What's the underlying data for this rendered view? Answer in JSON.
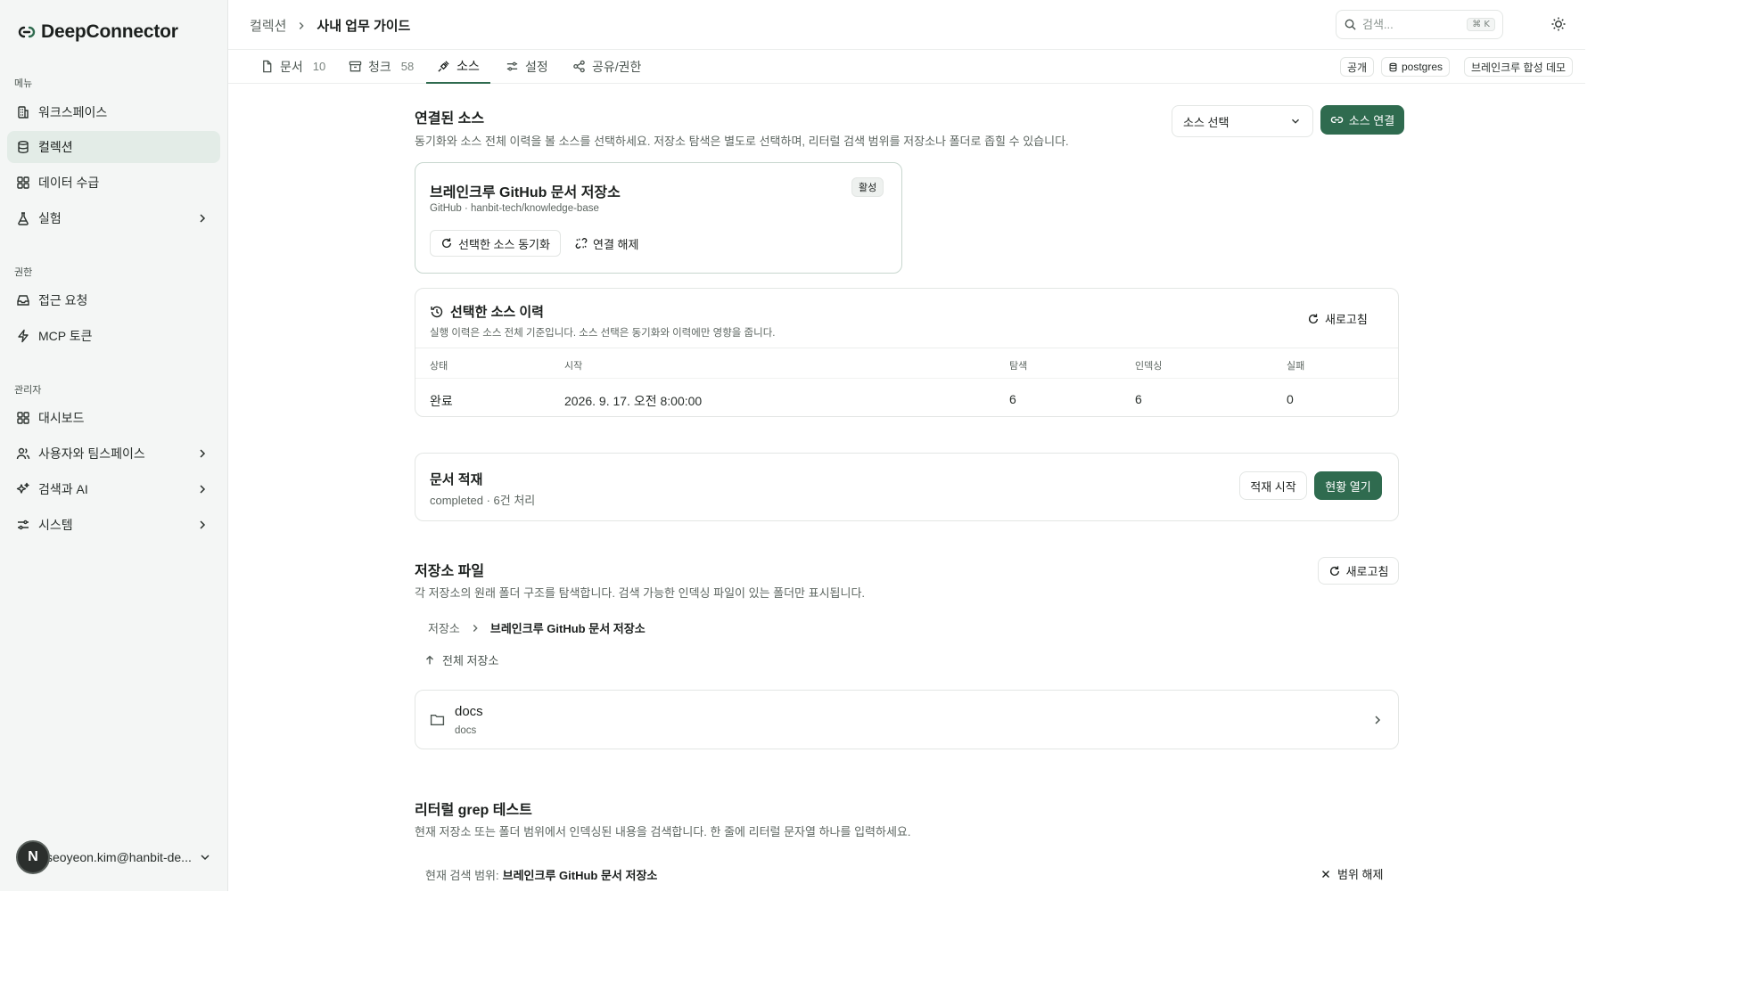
{
  "app": {
    "name": "DeepConnector"
  },
  "sidebar": {
    "sections": [
      {
        "label": "메뉴",
        "items": [
          {
            "label": "워크스페이스",
            "icon": "building-icon"
          },
          {
            "label": "컬렉션",
            "icon": "database-icon",
            "active": true
          },
          {
            "label": "데이터 수급",
            "icon": "grid-icon"
          },
          {
            "label": "실험",
            "icon": "flask-icon",
            "has_children": true
          }
        ]
      },
      {
        "label": "권한",
        "items": [
          {
            "label": "접근 요청",
            "icon": "inbox-icon"
          },
          {
            "label": "MCP 토큰",
            "icon": "bolt-icon"
          }
        ]
      },
      {
        "label": "관리자",
        "items": [
          {
            "label": "대시보드",
            "icon": "grid-icon"
          },
          {
            "label": "사용자와 팀스페이스",
            "icon": "users-icon",
            "has_children": true
          },
          {
            "label": "검색과 AI",
            "icon": "sparkles-icon",
            "has_children": true
          },
          {
            "label": "시스템",
            "icon": "sliders-icon",
            "has_children": true
          }
        ]
      }
    ],
    "user": {
      "initial": "N",
      "email": "seoyeon.kim@hanbit-de..."
    }
  },
  "header": {
    "breadcrumb": {
      "parent": "컬렉션",
      "current": "사내 업무 가이드"
    },
    "search": {
      "placeholder": "검색...",
      "shortcut": "⌘ K"
    }
  },
  "tabs": [
    {
      "label": "문서",
      "count": "10"
    },
    {
      "label": "청크",
      "count": "58"
    },
    {
      "label": "소스",
      "count": "",
      "active": true
    },
    {
      "label": "설정",
      "count": ""
    },
    {
      "label": "공유/권한",
      "count": ""
    }
  ],
  "tags": {
    "visibility": "공개",
    "db": "postgres",
    "workspace": "브레인크루 합성 데모"
  },
  "connected_sources": {
    "title": "연결된 소스",
    "description": "동기화와 소스 전체 이력을 볼 소스를 선택하세요. 저장소 탐색은 별도로 선택하며, 리터럴 검색 범위를 저장소나 폴더로 좁힐 수 있습니다.",
    "select_placeholder": "소스 선택",
    "connect_button": "소스 연결",
    "source": {
      "name": "브레인크루 GitHub 문서 저장소",
      "meta": "GitHub · hanbit-tech/knowledge-base",
      "status": "활성",
      "sync_button": "선택한 소스 동기화",
      "disconnect_button": "연결 해제"
    }
  },
  "history": {
    "title": "선택한 소스 이력",
    "note": "실행 이력은 소스 전체 기준입니다. 소스 선택은 동기화와 이력에만 영향을 줍니다.",
    "refresh": "새로고침",
    "columns": [
      "상태",
      "시작",
      "탐색",
      "인덱싱",
      "실패"
    ],
    "rows": [
      [
        "완료",
        "2026. 9. 17. 오전 8:00:00",
        "6",
        "6",
        "0"
      ]
    ]
  },
  "ingest": {
    "title": "문서 적재",
    "status": "completed · 6건 처리",
    "start_button": "적재 시작",
    "open_button": "현황 열기"
  },
  "repo_files": {
    "title": "저장소 파일",
    "description": "각 저장소의 원래 폴더 구조를 탐색합니다. 검색 가능한 인덱싱 파일이 있는 폴더만 표시됩니다.",
    "refresh": "새로고침",
    "crumb_root": "저장소",
    "crumb_current": "브레인크루 GitHub 문서 저장소",
    "up_link": "전체 저장소",
    "folders": [
      {
        "name": "docs",
        "path": "docs"
      }
    ]
  },
  "grep": {
    "title": "리터럴 grep 테스트",
    "description": "현재 저장소 또는 폴더 범위에서 인덱싱된 내용을 검색합니다. 한 줄에 리터럴 문자열 하나를 입력하세요.",
    "scope_label": "현재 검색 범위:",
    "scope_value": "브레인크루 GitHub 문서 저장소",
    "clear_scope": "범위 해제"
  },
  "colors": {
    "accent": "#2f6b4f",
    "sidebar_bg": "#f4f6f5",
    "active_nav": "#e3ece7"
  }
}
